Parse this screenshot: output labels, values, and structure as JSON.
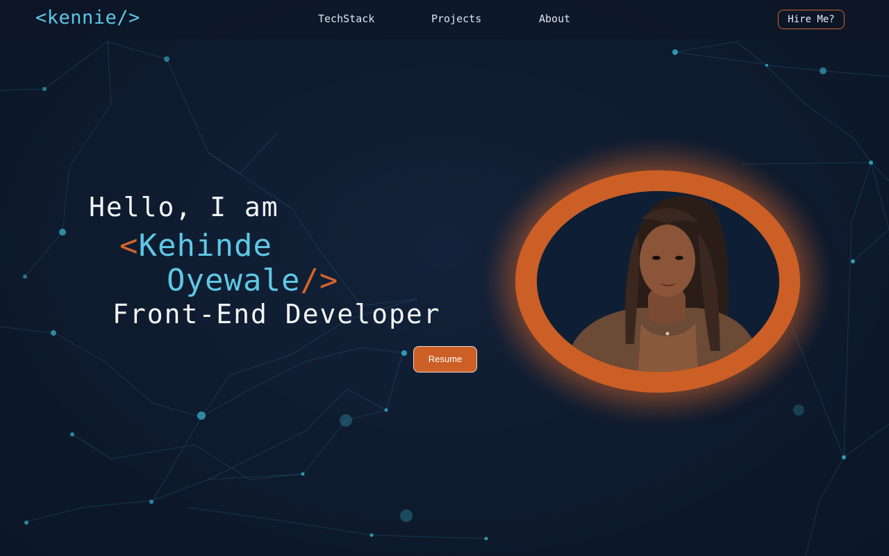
{
  "nav": {
    "logo": "<kennie/>",
    "links": [
      {
        "label": "TechStack"
      },
      {
        "label": "Projects"
      },
      {
        "label": "About"
      }
    ],
    "cta_label": "Hire Me?"
  },
  "hero": {
    "greeting": "Hello, I am",
    "open_bracket": "<",
    "first_name": "Kehinde",
    "last_name": "Oyewale",
    "close_bracket": "/>",
    "role": "Front-End Developer",
    "resume_label": "Resume"
  },
  "colors": {
    "background": "#0f1c30",
    "accent_cyan": "#5ec8e5",
    "accent_orange": "#cc5f26",
    "text": "#f2f5f9"
  }
}
